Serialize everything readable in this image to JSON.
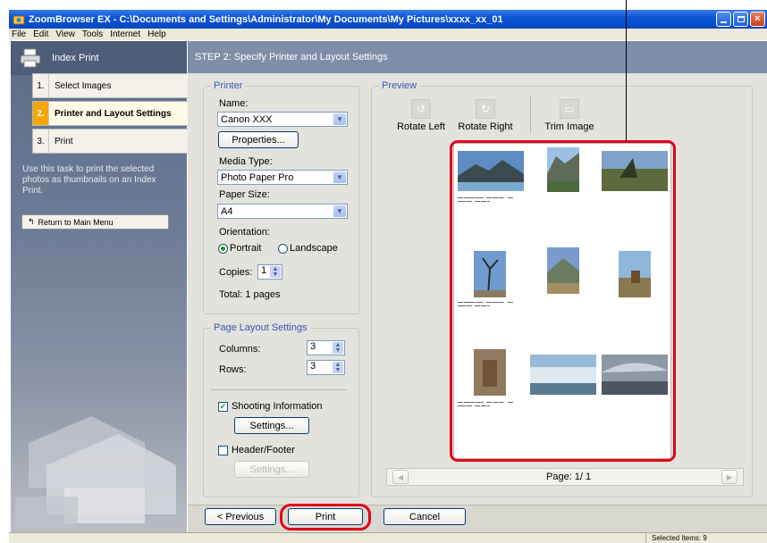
{
  "window": {
    "title": "ZoomBrowser EX  -  C:\\Documents and Settings\\Administrator\\My Documents\\My Pictures\\xxxx_xx_01"
  },
  "menu": [
    "File",
    "Edit",
    "View",
    "Tools",
    "Internet",
    "Help"
  ],
  "sidebar": {
    "title": "Index Print",
    "steps": [
      {
        "num": "1.",
        "label": "Select Images"
      },
      {
        "num": "2.",
        "label": "Printer and Layout Settings"
      },
      {
        "num": "3.",
        "label": "Print"
      }
    ],
    "description": "Use this task to print the selected photos as thumbnails on an Index Print.",
    "return_label": "Return to Main Menu"
  },
  "main": {
    "step_title": "STEP 2: Specify Printer and Layout Settings"
  },
  "printer": {
    "group_title": "Printer",
    "name_label": "Name:",
    "name_value": "Canon XXX",
    "properties_label": "Properties...",
    "media_type_label": "Media Type:",
    "media_type_value": "Photo Paper Pro",
    "paper_size_label": "Paper Size:",
    "paper_size_value": "A4",
    "orientation_label": "Orientation:",
    "portrait_label": "Portrait",
    "landscape_label": "Landscape",
    "orientation_selected": "Portrait",
    "copies_label": "Copies:",
    "copies_value": "1",
    "total_label": "Total: 1 pages"
  },
  "layout": {
    "group_title": "Page Layout Settings",
    "columns_label": "Columns:",
    "columns_value": "3",
    "rows_label": "Rows:",
    "rows_value": "3",
    "shooting_info_label": "Shooting Information",
    "shooting_info_checked": true,
    "settings_label": "Settings...",
    "header_footer_label": "Header/Footer",
    "header_footer_checked": false,
    "settings2_label": "Settings..."
  },
  "preview": {
    "group_title": "Preview",
    "rotate_left": "Rotate Left",
    "rotate_right": "Rotate Right",
    "trim_image": "Trim Image",
    "page_label": "Page: 1/ 1"
  },
  "buttons": {
    "previous": "< Previous",
    "print": "Print",
    "cancel": "Cancel"
  },
  "status": {
    "selected": "Selected Items: 9"
  },
  "colors": {
    "highlight_red": "#e2001a",
    "step_active": "#f7a600"
  }
}
